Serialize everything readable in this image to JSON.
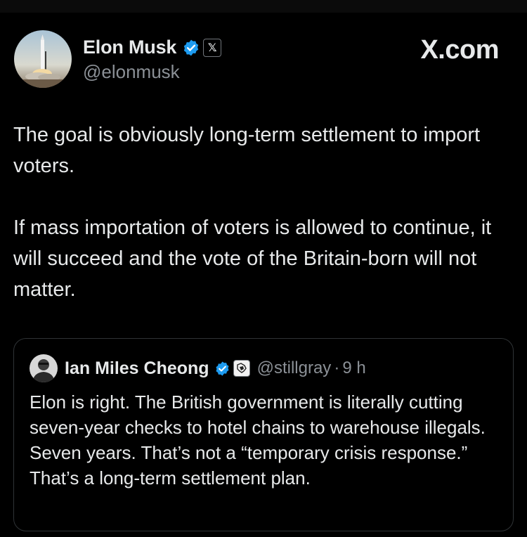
{
  "colors": {
    "background": "#000000",
    "text_primary": "#e7e9ea",
    "text_secondary": "#8b9096",
    "verified_blue": "#1d9bf0",
    "quote_border": "#2f3336"
  },
  "site_mark": "X.com",
  "tweet": {
    "author": {
      "display_name": "Elon Musk",
      "handle": "@elonmusk",
      "avatar_icon": "rocket-launch-avatar",
      "verified_icon": "verified-badge-icon",
      "affiliate_icon": "x-logo-icon",
      "affiliate_glyph": "𝕏"
    },
    "paragraphs": [
      "The goal is obviously long-term settlement to import voters.",
      "If mass importation of voters is allowed to continue, it will succeed and the vote of the Britain-born will not matter."
    ]
  },
  "quoted_tweet": {
    "author": {
      "display_name": "Ian Miles Cheong",
      "handle": "@stillgray",
      "avatar_icon": "profile-photo-avatar",
      "verified_icon": "verified-badge-icon",
      "affiliate_icon": "affiliate-logo-icon"
    },
    "separator": "·",
    "timestamp": "9 h",
    "text": "Elon is right. The British government is literally cutting seven-year checks to hotel chains to warehouse illegals. Seven years. That’s not a “temporary crisis response.” That’s a long-term settlement plan."
  }
}
